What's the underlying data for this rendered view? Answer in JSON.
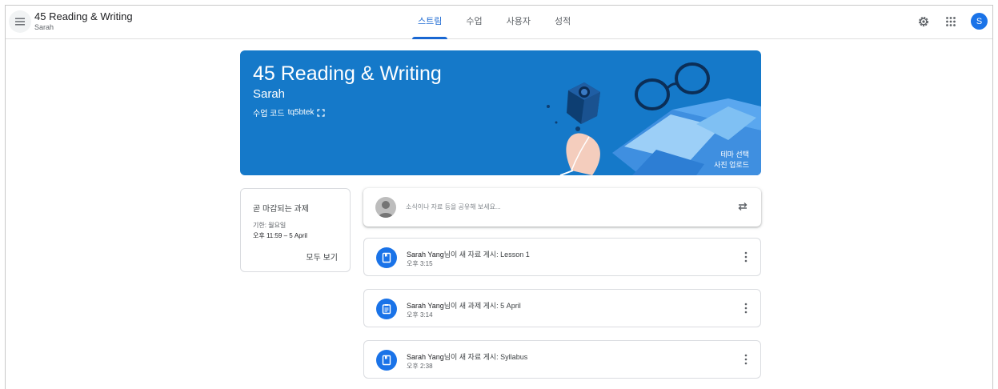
{
  "header": {
    "class_title": "45 Reading & Writing",
    "class_subtitle": "Sarah",
    "tabs": [
      {
        "label": "스트림",
        "active": true
      },
      {
        "label": "수업",
        "active": false
      },
      {
        "label": "사용자",
        "active": false
      },
      {
        "label": "성적",
        "active": false
      }
    ],
    "settings_icon": "settings-icon",
    "apps_icon": "apps-grid-icon",
    "account_initial": "S"
  },
  "banner": {
    "title": "45 Reading & Writing",
    "subtitle": "Sarah",
    "code_label": "수업 코드",
    "code_value": "tq5btek",
    "select_theme": "테마 선택",
    "upload_photo": "사진 업로드",
    "color": "#1579c9"
  },
  "due": {
    "title": "곧 마감되는 과제",
    "date": "기한: 월요일",
    "time": "오후 11:59 – 5 April",
    "view_all": "모두 보기"
  },
  "share": {
    "placeholder": "소식이나 자료 등을 공유해 보세요..."
  },
  "posts": [
    {
      "author": "Sarah Yang",
      "text": "님이 새 자료 게시: Lesson 1",
      "time": "오후 3:15",
      "icon": "material-icon"
    },
    {
      "author": "Sarah Yang",
      "text": "님이 새 과제 게시: 5 April",
      "time": "오후 3:14",
      "icon": "assignment-icon"
    },
    {
      "author": "Sarah Yang",
      "text": "님이 새 자료 게시: Syllabus",
      "time": "오후 2:38",
      "icon": "material-icon"
    }
  ],
  "colors": {
    "accent": "#1967d2",
    "icon_bg": "#1a73e8"
  }
}
